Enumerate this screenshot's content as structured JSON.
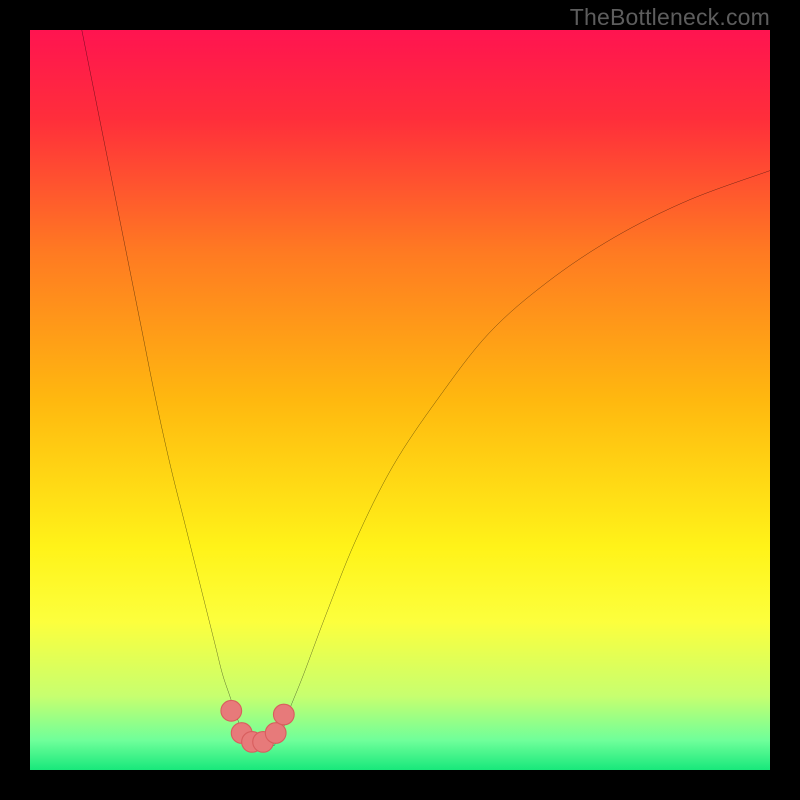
{
  "watermark": "TheBottleneck.com",
  "chart_data": {
    "type": "line",
    "title": "",
    "xlabel": "",
    "ylabel": "",
    "xlim": [
      0,
      100
    ],
    "ylim": [
      0,
      100
    ],
    "grid": false,
    "background_gradient": {
      "stops": [
        {
          "offset": 0.0,
          "color": "#ff1450"
        },
        {
          "offset": 0.12,
          "color": "#ff2e3b"
        },
        {
          "offset": 0.3,
          "color": "#ff7a22"
        },
        {
          "offset": 0.5,
          "color": "#ffb80f"
        },
        {
          "offset": 0.7,
          "color": "#fff319"
        },
        {
          "offset": 0.8,
          "color": "#fcff3d"
        },
        {
          "offset": 0.9,
          "color": "#c7ff6f"
        },
        {
          "offset": 0.96,
          "color": "#6fff9a"
        },
        {
          "offset": 1.0,
          "color": "#18e87b"
        }
      ]
    },
    "series": [
      {
        "name": "curve-left",
        "x": [
          7,
          9,
          11,
          13,
          15,
          17,
          19,
          21,
          23,
          25,
          26,
          27,
          28,
          28.8,
          29.4,
          30
        ],
        "y": [
          100,
          90,
          80,
          70,
          60,
          50,
          41,
          33,
          25,
          17,
          13,
          10,
          7,
          5,
          4,
          3.3
        ]
      },
      {
        "name": "curve-right",
        "x": [
          33,
          34,
          35,
          37,
          40,
          44,
          49,
          55,
          62,
          70,
          79,
          89,
          100
        ],
        "y": [
          3.3,
          5,
          8,
          13,
          21,
          31,
          41,
          50,
          59,
          66,
          72,
          77,
          81
        ]
      }
    ],
    "valley_flat": {
      "x_start": 30,
      "x_end": 33,
      "y": 3.3
    },
    "markers": [
      {
        "x": 27.2,
        "y": 8.0
      },
      {
        "x": 28.6,
        "y": 5.0
      },
      {
        "x": 30.0,
        "y": 3.8
      },
      {
        "x": 31.5,
        "y": 3.8
      },
      {
        "x": 33.2,
        "y": 5.0
      },
      {
        "x": 34.3,
        "y": 7.5
      }
    ],
    "marker_style": {
      "fill": "#e77a7a",
      "stroke": "#d85e5e",
      "r": 1.4
    }
  }
}
